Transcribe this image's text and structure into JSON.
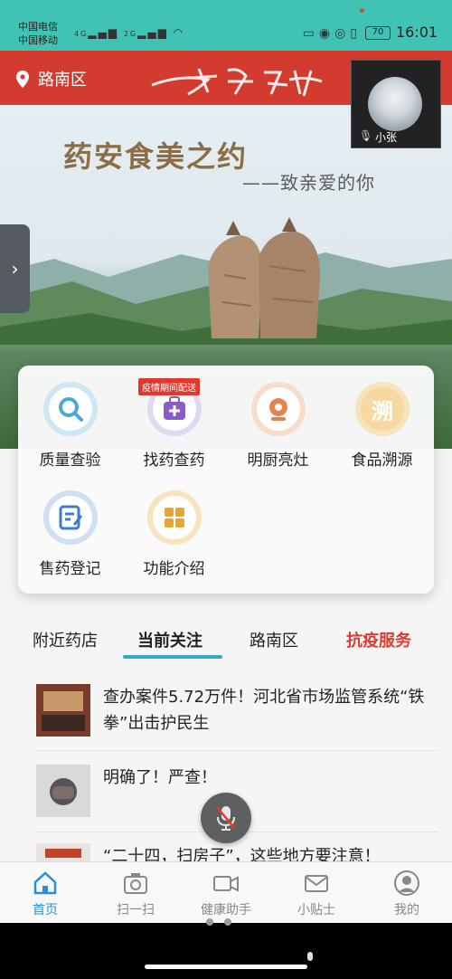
{
  "status_bar": {
    "carrier_1": "中国电信",
    "carrier_2": "中国移动",
    "signal_1": "4G",
    "signal_2": "2G",
    "battery": "70",
    "time": "16:01"
  },
  "header": {
    "location": "路南区",
    "banner_logo_alt": "药安食美"
  },
  "hero": {
    "title": "药安食美之约",
    "subtitle": "——致亲爱的你"
  },
  "pip": {
    "name": "小张"
  },
  "functions": [
    {
      "label": "质量查验",
      "icon": "search-icon",
      "color": "#4aa8d8"
    },
    {
      "label": "找药查药",
      "icon": "medicine-kit-icon",
      "color": "#8a5cc9",
      "badge": "疫情期间配送"
    },
    {
      "label": "明厨亮灶",
      "icon": "camera-eye-icon",
      "color": "#e7834a"
    },
    {
      "label": "食品溯源",
      "icon": "trace-icon",
      "color": "#e7a43a",
      "glyph": "溯"
    },
    {
      "label": "售药登记",
      "icon": "register-icon",
      "color": "#3d7bd1"
    },
    {
      "label": "功能介绍",
      "icon": "grid-icon",
      "color": "#e7a43a"
    }
  ],
  "tabs": [
    {
      "label": "附近药店"
    },
    {
      "label": "当前关注"
    },
    {
      "label": "路南区"
    },
    {
      "label": "抗疫服务"
    }
  ],
  "news": [
    {
      "title": "查办案件5.72万件！河北省市场监管系统“铁拳”出击护民生"
    },
    {
      "title": "明确了！严查！"
    },
    {
      "title": "“二十四，扫房子”，这些地方要注意！"
    }
  ],
  "bottom_nav": [
    {
      "label": "首页"
    },
    {
      "label": "扫一扫"
    },
    {
      "label": "健康助手"
    },
    {
      "label": "小贴士"
    },
    {
      "label": "我的"
    }
  ],
  "colors": {
    "status_bar": "#40c2b4",
    "header_red": "#d33b2e",
    "accent_blue": "#2b8fd6",
    "tab_underline": "#3aa6c8",
    "special_red": "#e03a2f"
  }
}
